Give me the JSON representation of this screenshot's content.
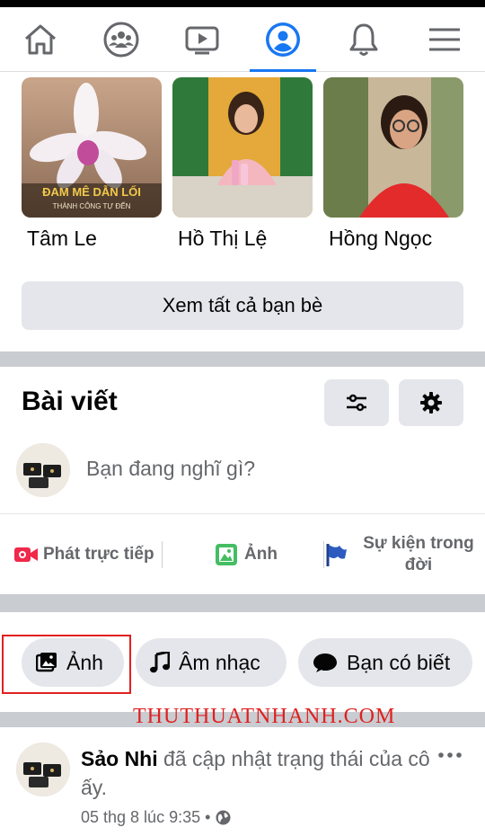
{
  "nav": {
    "tabs": [
      {
        "icon": "home-icon"
      },
      {
        "icon": "groups-icon"
      },
      {
        "icon": "watch-icon"
      },
      {
        "icon": "profile-icon",
        "active": true
      },
      {
        "icon": "notifications-icon"
      },
      {
        "icon": "menu-icon"
      }
    ],
    "accent": "#1877f2"
  },
  "friends": {
    "items": [
      {
        "name": "Tâm Le",
        "overlay_line1": "ĐAM MÊ DẪN LỐI",
        "overlay_line2": "THÀNH CÔNG TỰ ĐẾN"
      },
      {
        "name": "Hồ Thị Lệ"
      },
      {
        "name": "Hồng Ngọc"
      }
    ],
    "see_all_label": "Xem tất cả bạn bè"
  },
  "posts": {
    "title": "Bài viết",
    "composer_placeholder": "Bạn đang nghĩ gì?",
    "actions": [
      {
        "label": "Phát trực tiếp",
        "icon": "live-video-icon"
      },
      {
        "label": "Ảnh",
        "icon": "photo-icon"
      },
      {
        "label": "Sự kiện trong đời",
        "icon": "flag-icon"
      }
    ]
  },
  "chips": [
    {
      "label": "Ảnh",
      "icon": "photo-icon"
    },
    {
      "label": "Âm nhạc",
      "icon": "music-note-icon"
    },
    {
      "label": "Bạn có biết",
      "icon": "chat-bubble-icon"
    }
  ],
  "watermark": "THUTHUATNHANH.COM",
  "post": {
    "author": "Sảo Nhi",
    "action_text": " đã cập nhật trạng thái của cô ấy.",
    "timestamp": "05 thg 8 lúc 9:35 •",
    "privacy_icon": "globe-icon"
  }
}
